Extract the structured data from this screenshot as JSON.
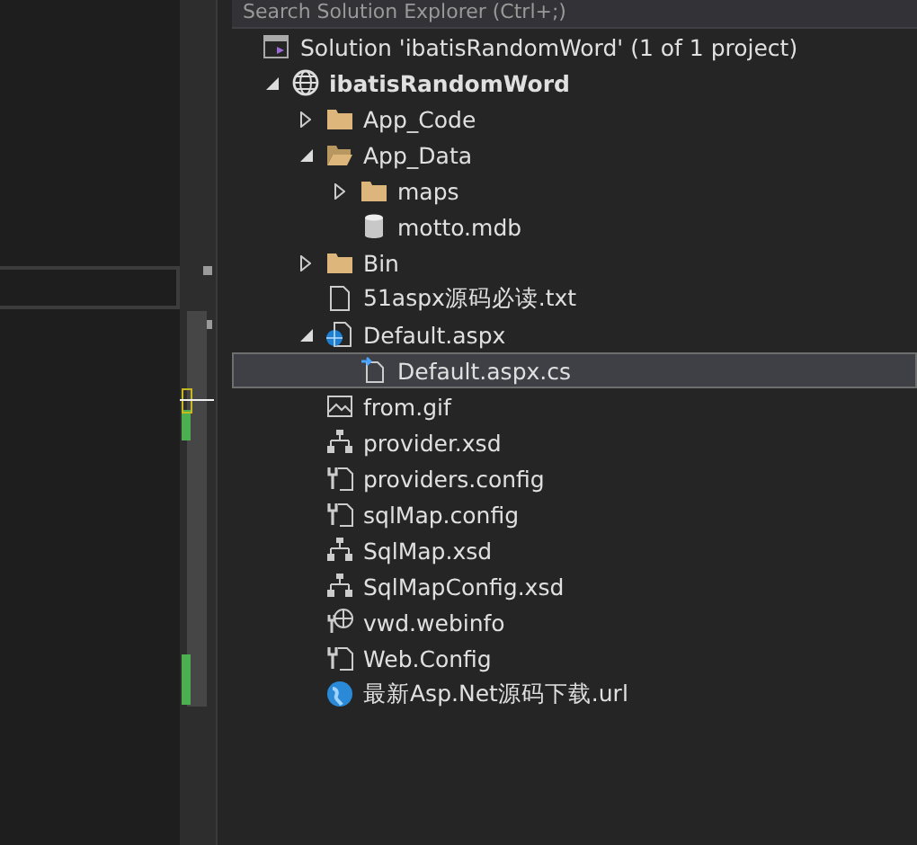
{
  "search": {
    "placeholder": "Search Solution Explorer (Ctrl+;)"
  },
  "tree": [
    {
      "kind": "solution",
      "label": "Solution 'ibatisRandomWord' (1 of 1 project)",
      "selected": false,
      "children": [
        {
          "kind": "project",
          "label": "ibatisRandomWord",
          "expanded": true,
          "selected": false,
          "children": [
            {
              "kind": "folder",
              "label": "App_Code",
              "expanded": false,
              "selected": false
            },
            {
              "kind": "folder-open",
              "label": "App_Data",
              "expanded": true,
              "selected": false,
              "children": [
                {
                  "kind": "folder",
                  "label": "maps",
                  "expanded": false,
                  "selected": false
                },
                {
                  "kind": "database",
                  "label": "motto.mdb",
                  "selected": false
                }
              ]
            },
            {
              "kind": "folder",
              "label": "Bin",
              "expanded": false,
              "selected": false
            },
            {
              "kind": "text",
              "label": "51aspx源码必读.txt",
              "selected": false
            },
            {
              "kind": "aspx",
              "label": "Default.aspx",
              "expanded": true,
              "selected": false,
              "children": [
                {
                  "kind": "cs",
                  "label": "Default.aspx.cs",
                  "selected": true
                }
              ]
            },
            {
              "kind": "image",
              "label": "from.gif",
              "selected": false
            },
            {
              "kind": "xsd",
              "label": "provider.xsd",
              "selected": false
            },
            {
              "kind": "config",
              "label": "providers.config",
              "selected": false
            },
            {
              "kind": "config",
              "label": "sqlMap.config",
              "selected": false
            },
            {
              "kind": "xsd",
              "label": "SqlMap.xsd",
              "selected": false
            },
            {
              "kind": "xsd",
              "label": "SqlMapConfig.xsd",
              "selected": false
            },
            {
              "kind": "webinfo",
              "label": "vwd.webinfo",
              "selected": false
            },
            {
              "kind": "config",
              "label": "Web.Config",
              "selected": false
            },
            {
              "kind": "url",
              "label": "最新Asp.Net源码下载.url",
              "selected": false
            }
          ]
        }
      ]
    }
  ]
}
